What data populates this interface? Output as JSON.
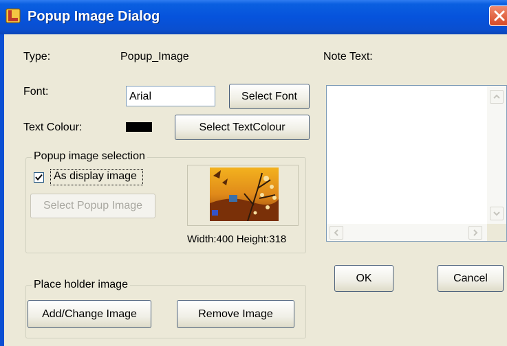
{
  "window": {
    "title": "Popup Image Dialog",
    "accent": "#0653dc",
    "close_color": "#d64a26",
    "icon": "app-icon"
  },
  "fields": {
    "type_label": "Type:",
    "type_value": "Popup_Image",
    "font_label": "Font:",
    "font_value": "Arial",
    "text_colour_label": "Text Colour:",
    "text_colour_value": "#000000",
    "note_text_label": "Note Text:",
    "note_text_value": ""
  },
  "buttons": {
    "select_font": "Select Font",
    "select_text_colour": "Select TextColour",
    "select_popup_image": "Select Popup Image",
    "add_change_image": "Add/Change Image",
    "remove_image": "Remove Image",
    "ok": "OK",
    "cancel": "Cancel"
  },
  "popup_group": {
    "title": "Popup image selection",
    "checkbox_label": "As display image",
    "checked": true,
    "image_size_text": "Width:400 Height:318"
  },
  "placeholder_group": {
    "title": "Place holder image"
  }
}
